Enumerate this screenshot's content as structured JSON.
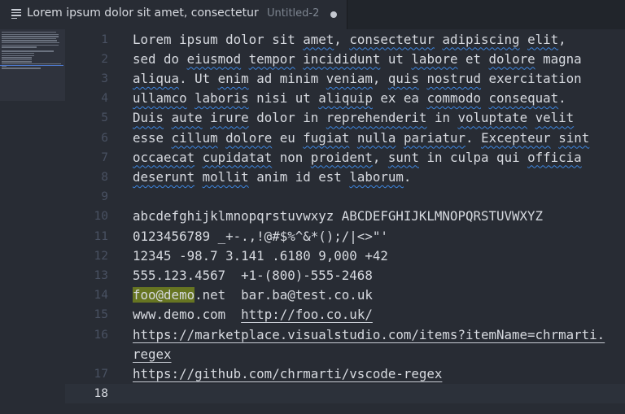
{
  "tab": {
    "icon": "file-text-icon",
    "title": "Lorem ipsum dolor sit amet, consectetur",
    "description": "Untitled-2",
    "dirty": true
  },
  "editor": {
    "current_line": 18,
    "lines": [
      {
        "num": "1",
        "segs": [
          {
            "t": "Lorem ipsum dolor sit "
          },
          {
            "t": "amet",
            "s": "sq"
          },
          {
            "t": ", "
          },
          {
            "t": "consectetur",
            "s": "sq"
          },
          {
            "t": " "
          },
          {
            "t": "adipiscing",
            "s": "sq"
          },
          {
            "t": " "
          },
          {
            "t": "elit",
            "s": "sq"
          },
          {
            "t": ","
          }
        ]
      },
      {
        "num": "2",
        "segs": [
          {
            "t": "sed do "
          },
          {
            "t": "eiusmod",
            "s": "sq"
          },
          {
            "t": " "
          },
          {
            "t": "tempor",
            "s": "sq"
          },
          {
            "t": " "
          },
          {
            "t": "incididunt",
            "s": "sq"
          },
          {
            "t": " ut "
          },
          {
            "t": "labore",
            "s": "sq"
          },
          {
            "t": " et "
          },
          {
            "t": "dolore",
            "s": "sq"
          },
          {
            "t": " magna"
          }
        ]
      },
      {
        "num": "3",
        "segs": [
          {
            "t": "aliqua",
            "s": "sq"
          },
          {
            "t": ". Ut "
          },
          {
            "t": "enim",
            "s": "sq"
          },
          {
            "t": " ad minim "
          },
          {
            "t": "veniam",
            "s": "sq"
          },
          {
            "t": ", "
          },
          {
            "t": "quis",
            "s": "sq"
          },
          {
            "t": " "
          },
          {
            "t": "nostrud",
            "s": "sq"
          },
          {
            "t": " exercitation"
          }
        ]
      },
      {
        "num": "4",
        "segs": [
          {
            "t": "ullamco",
            "s": "sq"
          },
          {
            "t": " "
          },
          {
            "t": "laboris",
            "s": "sq"
          },
          {
            "t": " nisi ut "
          },
          {
            "t": "aliquip",
            "s": "sq"
          },
          {
            "t": " ex ea "
          },
          {
            "t": "commodo",
            "s": "sq"
          },
          {
            "t": " "
          },
          {
            "t": "consequat",
            "s": "sq"
          },
          {
            "t": "."
          }
        ]
      },
      {
        "num": "5",
        "segs": [
          {
            "t": "Duis",
            "s": "sq"
          },
          {
            "t": " "
          },
          {
            "t": "aute",
            "s": "sq"
          },
          {
            "t": " "
          },
          {
            "t": "irure",
            "s": "sq"
          },
          {
            "t": " dolor in "
          },
          {
            "t": "reprehenderit",
            "s": "sq"
          },
          {
            "t": " in "
          },
          {
            "t": "voluptate",
            "s": "sq"
          },
          {
            "t": " "
          },
          {
            "t": "velit",
            "s": "sq"
          }
        ]
      },
      {
        "num": "6",
        "segs": [
          {
            "t": "esse "
          },
          {
            "t": "cillum",
            "s": "sq"
          },
          {
            "t": " "
          },
          {
            "t": "dolore",
            "s": "sq"
          },
          {
            "t": " eu "
          },
          {
            "t": "fugiat",
            "s": "sq"
          },
          {
            "t": " "
          },
          {
            "t": "nulla",
            "s": "sq"
          },
          {
            "t": " "
          },
          {
            "t": "pariatur",
            "s": "sq"
          },
          {
            "t": ". "
          },
          {
            "t": "Excepteur",
            "s": "sq"
          },
          {
            "t": " "
          },
          {
            "t": "sint",
            "s": "sq"
          }
        ]
      },
      {
        "num": "7",
        "segs": [
          {
            "t": "occaecat",
            "s": "sq"
          },
          {
            "t": " "
          },
          {
            "t": "cupidatat",
            "s": "sq"
          },
          {
            "t": " non "
          },
          {
            "t": "proident",
            "s": "sq"
          },
          {
            "t": ", "
          },
          {
            "t": "sunt",
            "s": "sq"
          },
          {
            "t": " in culpa qui "
          },
          {
            "t": "officia",
            "s": "sq"
          }
        ]
      },
      {
        "num": "8",
        "segs": [
          {
            "t": "deserunt",
            "s": "sq"
          },
          {
            "t": " "
          },
          {
            "t": "mollit",
            "s": "sq"
          },
          {
            "t": " anim id est "
          },
          {
            "t": "laborum",
            "s": "sq"
          },
          {
            "t": "."
          }
        ]
      },
      {
        "num": "9",
        "segs": []
      },
      {
        "num": "10",
        "segs": [
          {
            "t": "abcdefghijklmnopqrstuvwxyz ABCDEFGHIJKLMNOPQRSTUVWXYZ"
          }
        ]
      },
      {
        "num": "11",
        "segs": [
          {
            "t": "0123456789 _+-.,!@#$%^&*();/|<>\"'"
          }
        ]
      },
      {
        "num": "12",
        "segs": [
          {
            "t": "12345 -98.7 3.141 .6180 9,000 +42"
          }
        ]
      },
      {
        "num": "13",
        "segs": [
          {
            "t": "555.123.4567  +1-(800)-555-2468"
          }
        ]
      },
      {
        "num": "14",
        "segs": [
          {
            "t": "foo@demo",
            "s": "hl"
          },
          {
            "t": ".net  bar.ba@test.co.uk"
          }
        ]
      },
      {
        "num": "15",
        "segs": [
          {
            "t": "www.demo.com  "
          },
          {
            "t": "http://foo.co.uk/",
            "s": "ln"
          }
        ]
      },
      {
        "num": "16",
        "segs": [
          {
            "t": "https://marketplace.visualstudio.com/items?itemName=chrmarti.",
            "s": "ln"
          }
        ]
      },
      {
        "num": "",
        "segs": [
          {
            "t": "regex",
            "s": "ln"
          }
        ]
      },
      {
        "num": "17",
        "segs": [
          {
            "t": "https://github.com/chrmarti/vscode-regex",
            "s": "ln"
          }
        ]
      },
      {
        "num": "18",
        "segs": []
      }
    ]
  },
  "colors": {
    "background": "#282c34",
    "squiggle": "#3d86e0",
    "find_highlight": "#677522"
  }
}
